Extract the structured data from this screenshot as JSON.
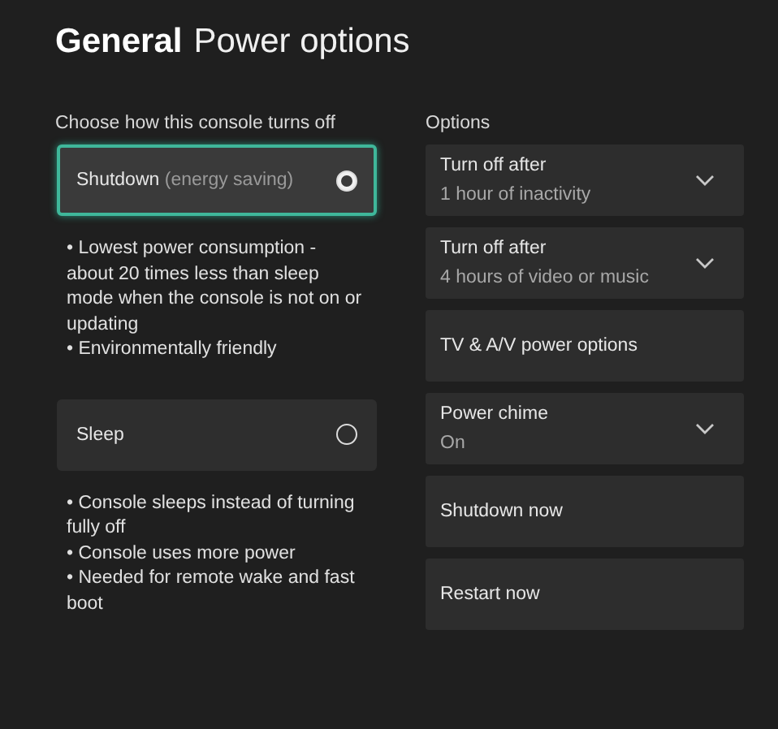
{
  "header": {
    "section": "General",
    "title": "Power options"
  },
  "modes": {
    "heading": "Choose how this console turns off",
    "items": [
      {
        "label": "Shutdown",
        "note": "(energy saving)",
        "selected": true,
        "focused": true,
        "details": [
          "• Lowest power consumption - about 20 times less than sleep mode when the console is not on or updating",
          "• Environmentally friendly"
        ]
      },
      {
        "label": "Sleep",
        "selected": false,
        "focused": false,
        "details": [
          "• Console sleeps instead of turning fully off",
          "• Console uses more power",
          "• Needed for remote wake and fast boot"
        ]
      }
    ]
  },
  "options": {
    "heading": "Options",
    "items": [
      {
        "kind": "dropdown",
        "label": "Turn off after",
        "value": "1 hour of inactivity"
      },
      {
        "kind": "dropdown",
        "label": "Turn off after",
        "value": "4 hours of video or music"
      },
      {
        "kind": "action",
        "label": "TV & A/V power options"
      },
      {
        "kind": "dropdown",
        "label": "Power chime",
        "value": "On"
      },
      {
        "kind": "action",
        "label": "Shutdown now"
      },
      {
        "kind": "action",
        "label": "Restart now"
      }
    ]
  }
}
